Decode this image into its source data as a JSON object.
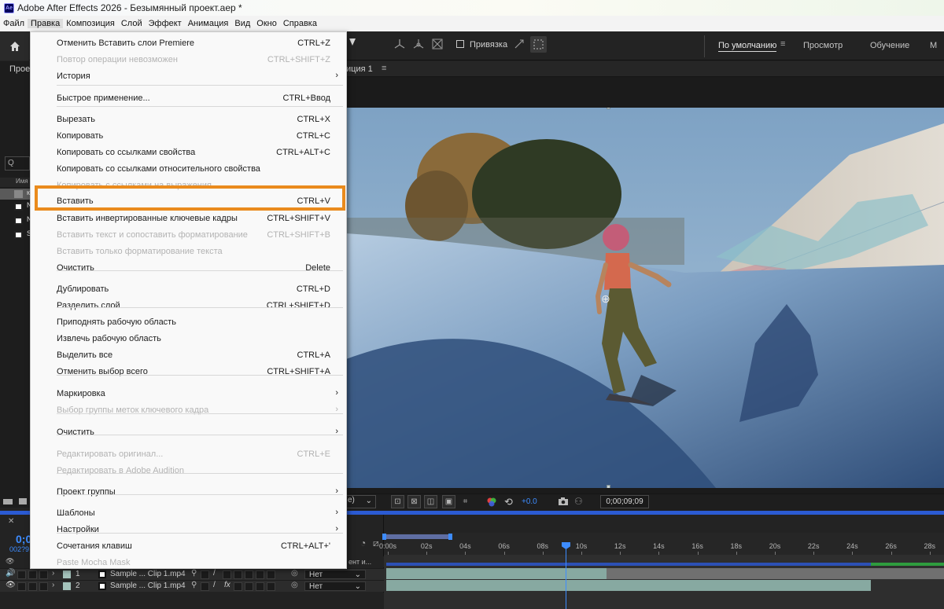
{
  "window": {
    "app_badge": "Ae",
    "title": "Adobe After Effects 2026 - Безымянный проект.aep *"
  },
  "menubar": [
    "Файл",
    "Правка",
    "Композиция",
    "Слой",
    "Эффект",
    "Анимация",
    "Вид",
    "Окно",
    "Справка"
  ],
  "toolbar": {
    "snapping_label": "Привязка"
  },
  "workspaces": {
    "default": "По умолчанию",
    "review": "Просмотр",
    "learn": "Обучение",
    "more": "М"
  },
  "left_panel_fragments": {
    "project_tab": "Прое",
    "search_icon_label": "Q",
    "name_col": "Имя",
    "row1": "к",
    "row2": "N",
    "row3": "N",
    "row4": "S"
  },
  "comp": {
    "tab_label": "иция 1",
    "tab_menu": "≡",
    "fit_value": "е)",
    "exposure": "+0.0",
    "timecode": "0;00;09;09"
  },
  "timeline": {
    "timecode": "0;0",
    "frames": "002?9",
    "ruler": [
      "0:00s",
      "02s",
      "04s",
      "06s",
      "08s",
      "10s",
      "12s",
      "14s",
      "16s",
      "18s",
      "20s",
      "22s",
      "24s",
      "26s",
      "28s"
    ],
    "header_right": "ент и...",
    "layers": [
      {
        "num": "1",
        "name": "Sample ... Clip 1.mp4",
        "mode": "Нет"
      },
      {
        "num": "2",
        "name": "Sample ... Clip 1.mp4",
        "mode": "Нет"
      }
    ]
  },
  "edit_menu": {
    "items": [
      {
        "label": "Отменить Вставить слои Premiere",
        "shortcut": "CTRL+Z",
        "disabled": false
      },
      {
        "label": "Повтор операции невозможен",
        "shortcut": "CTRL+SHIFT+Z",
        "disabled": true
      },
      {
        "label": "История",
        "shortcut": "",
        "submenu": true
      },
      {
        "label": "Быстрое применение...",
        "shortcut": "CTRL+Ввод"
      },
      {
        "label": "Вырезать",
        "shortcut": "CTRL+X"
      },
      {
        "label": "Копировать",
        "shortcut": "CTRL+C"
      },
      {
        "label": "Копировать со ссылками свойства",
        "shortcut": "CTRL+ALT+C"
      },
      {
        "label": "Копировать со ссылками относительного свойства",
        "shortcut": ""
      },
      {
        "label": "Копировать с ссылками на выражения",
        "shortcut": "",
        "disabled": true
      },
      {
        "label": "Вставить",
        "shortcut": "CTRL+V"
      },
      {
        "label": "Вставить инвертированные ключевые кадры",
        "shortcut": "CTRL+SHIFT+V"
      },
      {
        "label": "Вставить текст и сопоставить форматирование",
        "shortcut": "CTRL+SHIFT+B",
        "disabled": true
      },
      {
        "label": "Вставить только форматирование текста",
        "shortcut": "",
        "disabled": true
      },
      {
        "label": "Очистить",
        "shortcut": "Delete"
      },
      {
        "label": "Дублировать",
        "shortcut": "CTRL+D"
      },
      {
        "label": "Разделить слой",
        "shortcut": "CTRL+SHIFT+D"
      },
      {
        "label": "Приподнять рабочую область",
        "shortcut": ""
      },
      {
        "label": "Извлечь рабочую область",
        "shortcut": ""
      },
      {
        "label": "Выделить все",
        "shortcut": "CTRL+A"
      },
      {
        "label": "Отменить выбор всего",
        "shortcut": "CTRL+SHIFT+A"
      },
      {
        "label": "Маркировка",
        "shortcut": "",
        "submenu": true
      },
      {
        "label": "Выбор группы меток ключевого кадра",
        "shortcut": "",
        "submenu": true,
        "disabled": true
      },
      {
        "label": "Очистить",
        "shortcut": "",
        "submenu": true
      },
      {
        "label": "Редактировать оригинал...",
        "shortcut": "CTRL+E",
        "disabled": true
      },
      {
        "label": "Редактировать в Adobe Audition",
        "shortcut": "",
        "disabled": true
      },
      {
        "label": "Проект группы",
        "shortcut": "",
        "submenu": true
      },
      {
        "label": "Шаблоны",
        "shortcut": "",
        "submenu": true
      },
      {
        "label": "Настройки",
        "shortcut": "",
        "submenu": true
      },
      {
        "label": "Сочетания клавиш",
        "shortcut": "CTRL+ALT+'"
      },
      {
        "label": "Paste Mocha Mask",
        "shortcut": "",
        "disabled": true
      }
    ],
    "highlight_color": "#ea8b1d"
  }
}
